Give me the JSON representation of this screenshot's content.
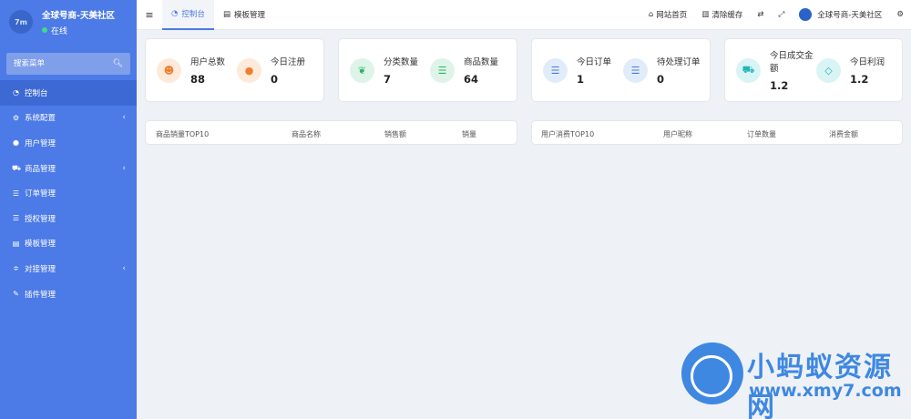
{
  "brand": {
    "name": "全球号商-天美社区",
    "status": "在线",
    "logo_text": "7m"
  },
  "search": {
    "placeholder": "搜索菜单"
  },
  "sidebar": {
    "items": [
      {
        "label": "控制台",
        "icon": "dashboard-icon",
        "active": true
      },
      {
        "label": "系统配置",
        "icon": "gear-icon",
        "has_children": true
      },
      {
        "label": "用户管理",
        "icon": "user-icon"
      },
      {
        "label": "商品管理",
        "icon": "cart-icon",
        "has_children": true
      },
      {
        "label": "订单管理",
        "icon": "list-icon"
      },
      {
        "label": "授权管理",
        "icon": "list-icon"
      },
      {
        "label": "模板管理",
        "icon": "template-icon"
      },
      {
        "label": "对接管理",
        "icon": "sliders-icon",
        "has_children": true
      },
      {
        "label": "插件管理",
        "icon": "plugin-icon"
      }
    ]
  },
  "topbar": {
    "tabs": [
      {
        "label": "控制台",
        "active": true
      },
      {
        "label": "模板管理",
        "active": false
      }
    ],
    "home_label": "网站首页",
    "clear_cache_label": "清除缓存",
    "site_name": "全球号商-天美社区"
  },
  "stats": [
    {
      "label": "用户总数",
      "value": "88",
      "icon": "users-icon"
    },
    {
      "label": "今日注册",
      "value": "0",
      "icon": "user-icon"
    },
    {
      "label": "分类数量",
      "value": "7",
      "icon": "leaf-icon"
    },
    {
      "label": "商品数量",
      "value": "64",
      "icon": "list-icon"
    },
    {
      "label": "今日订单",
      "value": "1",
      "icon": "list-icon"
    },
    {
      "label": "待处理订单",
      "value": "0",
      "icon": "list-icon"
    },
    {
      "label_line1": "今日成交金",
      "label_line2": "额",
      "value": "1.2",
      "icon": "cart-icon"
    },
    {
      "label": "今日利润",
      "value": "1.2",
      "icon": "diamond-icon"
    }
  ],
  "tables": {
    "product_top": {
      "headers": [
        "商品销量TOP10",
        "商品名称",
        "销售额",
        "销量"
      ]
    },
    "user_top": {
      "headers": [
        "用户消费TOP10",
        "用户昵称",
        "订单数量",
        "消费金额"
      ]
    }
  },
  "watermark": {
    "title": "小蚂蚁资源网",
    "url": "www.xmy7.com"
  },
  "colors": {
    "sidebar": "#4c7ae6",
    "accent": "#4c7ae6",
    "background": "#eef1f5"
  }
}
